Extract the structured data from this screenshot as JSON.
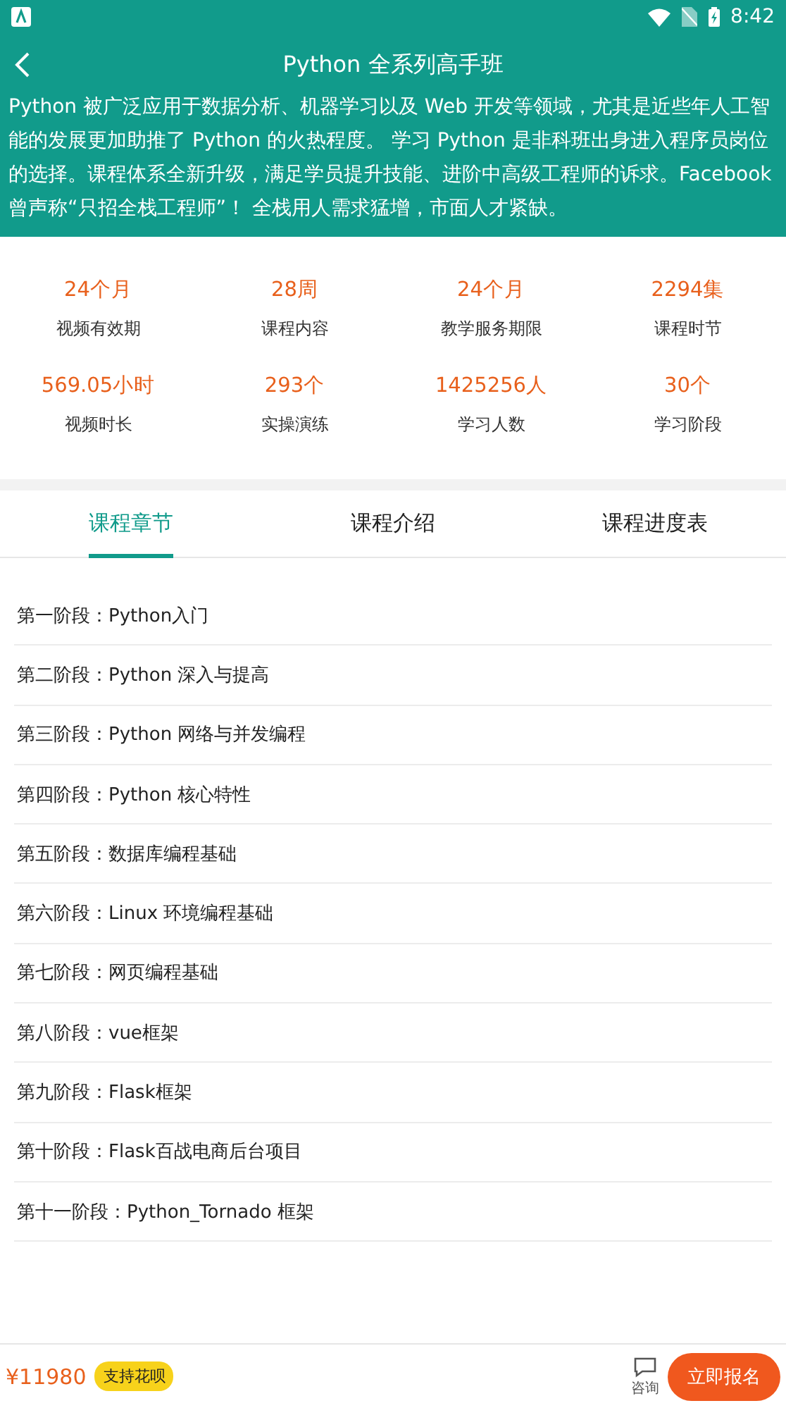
{
  "status_bar": {
    "time": "8:42"
  },
  "header": {
    "title": "Python 全系列高手班",
    "description": "Python 被广泛应用于数据分析、机器学习以及 Web 开发等领域，尤其是近些年人工智能的发展更加助推了 Python 的火热程度。 学习 Python 是非科班出身进入程序员岗位的选择。课程体系全新升级，满足学员提升技能、进阶中高级工程师的诉求。Facebook曾声称“只招全栈工程师”！ 全栈用人需求猛增，市面人才紧缺。"
  },
  "stats": [
    {
      "value": "24个月",
      "label": "视频有效期"
    },
    {
      "value": "28周",
      "label": "课程内容"
    },
    {
      "value": "24个月",
      "label": "教学服务期限"
    },
    {
      "value": "2294集",
      "label": "课程时节"
    },
    {
      "value": "569.05小时",
      "label": "视频时长"
    },
    {
      "value": "293个",
      "label": "实操演练"
    },
    {
      "value": "1425256人",
      "label": "学习人数"
    },
    {
      "value": "30个",
      "label": "学习阶段"
    }
  ],
  "tabs": [
    {
      "label": "课程章节",
      "selected": true
    },
    {
      "label": "课程介绍",
      "selected": false
    },
    {
      "label": "课程进度表",
      "selected": false
    }
  ],
  "chapters": [
    "第一阶段：Python入门",
    "第二阶段：Python 深入与提高",
    "第三阶段：Python 网络与并发编程",
    "第四阶段：Python 核心特性",
    "第五阶段：数据库编程基础",
    "第六阶段：Linux 环境编程基础",
    "第七阶段：网页编程基础",
    "第八阶段：vue框架",
    "第九阶段：Flask框架",
    "第十阶段：Flask百战电商后台项目",
    "第十一阶段：Python_Tornado 框架"
  ],
  "bottom_bar": {
    "price": "¥11980",
    "badge": "支持花呗",
    "consult": "咨询",
    "buy": "立即报名"
  }
}
